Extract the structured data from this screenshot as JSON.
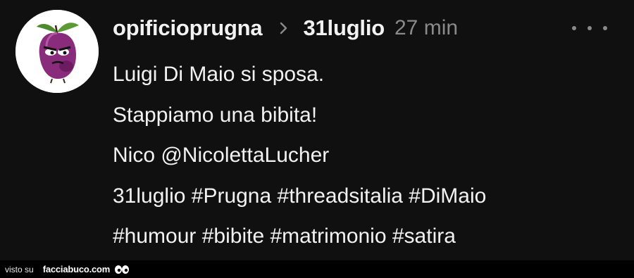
{
  "post": {
    "username": "opificioprugna",
    "topic": "31luglio",
    "time": "27 min",
    "lines": [
      "Luigi Di Maio si sposa.",
      "Stappiamo una bibita!",
      "Nico @NicolettaLucher",
      "31luglio #Prugna #threadsitalia #DiMaio",
      "#humour #bibite #matrimonio #satira"
    ]
  },
  "footer": {
    "visto": "visto su",
    "site": "facciabuco.com"
  },
  "icons": {
    "avatar": "plum-character-avatar",
    "separator": "chevron-right-icon",
    "more": "more-options-icon",
    "eyes": "eyes-icon"
  },
  "colors": {
    "background": "#101010",
    "text": "#f2f2f2",
    "muted": "#8a8a8a",
    "plum": "#7a1f6e"
  }
}
